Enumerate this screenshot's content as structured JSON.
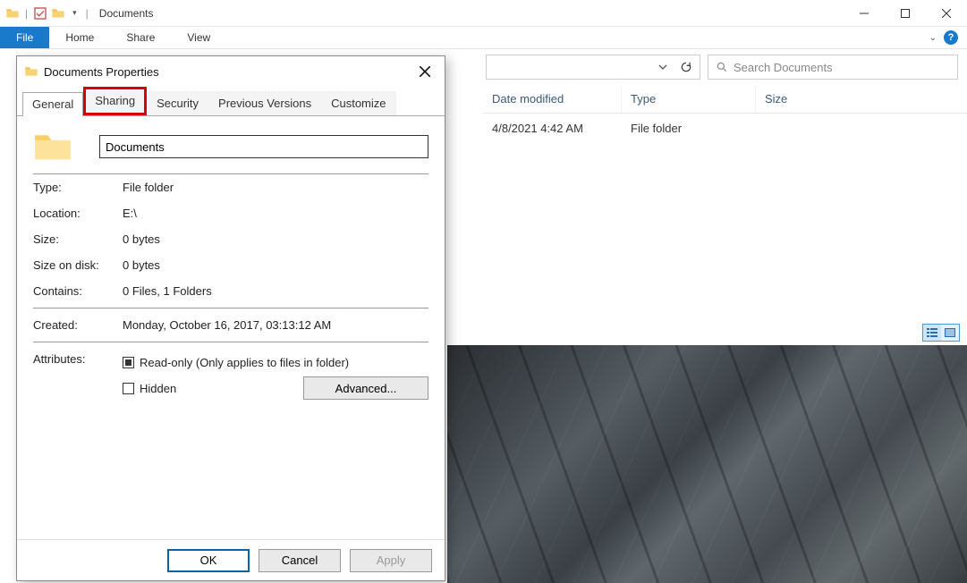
{
  "window": {
    "title": "Documents"
  },
  "ribbon": {
    "file": "File",
    "tabs": [
      "Home",
      "Share",
      "View"
    ]
  },
  "search": {
    "placeholder": "Search Documents"
  },
  "columns": {
    "date": "Date modified",
    "type": "Type",
    "size": "Size"
  },
  "rows": [
    {
      "date": "4/8/2021 4:42 AM",
      "type": "File folder",
      "size": ""
    }
  ],
  "dialog": {
    "title": "Documents Properties",
    "tabs": {
      "general": "General",
      "sharing": "Sharing",
      "security": "Security",
      "previous": "Previous Versions",
      "customize": "Customize"
    },
    "folder_name": "Documents",
    "fields": {
      "type_label": "Type:",
      "type_value": "File folder",
      "location_label": "Location:",
      "location_value": "E:\\",
      "size_label": "Size:",
      "size_value": "0 bytes",
      "disk_label": "Size on disk:",
      "disk_value": "0 bytes",
      "contains_label": "Contains:",
      "contains_value": "0 Files, 1 Folders",
      "created_label": "Created:",
      "created_value": "Monday, October 16, 2017, 03:13:12 AM",
      "attributes_label": "Attributes:",
      "readonly_label": "Read-only (Only applies to files in folder)",
      "hidden_label": "Hidden",
      "advanced": "Advanced..."
    },
    "buttons": {
      "ok": "OK",
      "cancel": "Cancel",
      "apply": "Apply"
    }
  }
}
